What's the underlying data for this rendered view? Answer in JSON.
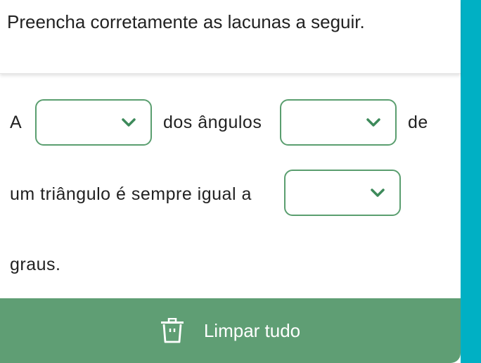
{
  "instruction": "Preencha corretamente as lacunas a seguir.",
  "sentence": {
    "part1": "A",
    "part2": "dos ângulos",
    "part3": "de",
    "part4": "um triângulo é sempre igual a",
    "part5": "graus."
  },
  "dropdowns": [
    {
      "selected": ""
    },
    {
      "selected": ""
    },
    {
      "selected": ""
    }
  ],
  "footer": {
    "clear_label": "Limpar tudo",
    "icon": "trash-icon"
  },
  "colors": {
    "rail": "#00b0c4",
    "footer": "#5f9e74",
    "dropdown_border": "#5a9e6f",
    "chevron": "#3d8a5a"
  }
}
